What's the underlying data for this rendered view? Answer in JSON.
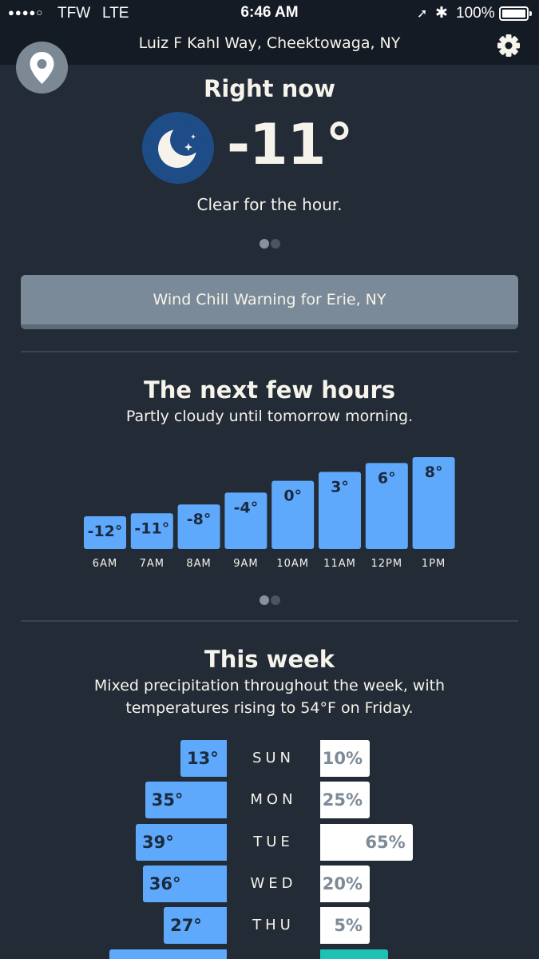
{
  "status_bar": {
    "signal": "●●●●○",
    "carrier": "TFW",
    "network": "LTE",
    "time": "6:46 AM",
    "battery": "100%"
  },
  "header": {
    "location": "Luiz F Kahl Way, Cheektowaga, NY",
    "icons": [
      "gear-icon",
      "location-pin-icon"
    ]
  },
  "current": {
    "title": "Right now",
    "icon": "clear-night-moon-icon",
    "temperature": "-11°",
    "summary": "Clear for the hour."
  },
  "alert": {
    "label": "Wind Chill Warning for Erie, NY"
  },
  "hourly": {
    "title": "The next few hours",
    "summary": "Partly cloudy until tomorrow morning."
  },
  "chart_data": {
    "type": "bar",
    "categories": [
      "6AM",
      "7AM",
      "8AM",
      "9AM",
      "10AM",
      "11AM",
      "12PM",
      "1PM"
    ],
    "values": [
      -12,
      -11,
      -8,
      -4,
      0,
      3,
      6,
      8
    ],
    "labels": [
      "-12°",
      "-11°",
      "-8°",
      "-4°",
      "0°",
      "3°",
      "6°",
      "8°"
    ],
    "bar_color": "#5ea9fb",
    "label_color": "#1c2a3f",
    "tick_color": "#f6f3ea"
  },
  "weekly": {
    "title": "This week",
    "summary_line1": "Mixed precipitation throughout the week, with",
    "summary_line2": "temperatures rising to 54°F on Friday.",
    "days": [
      {
        "day": "SUN",
        "temp": "13°",
        "temp_value": 13,
        "precip": "10%",
        "precip_value": 10
      },
      {
        "day": "MON",
        "temp": "35°",
        "temp_value": 35,
        "precip": "25%",
        "precip_value": 25
      },
      {
        "day": "TUE",
        "temp": "39°",
        "temp_value": 39,
        "precip": "65%",
        "precip_value": 65
      },
      {
        "day": "WED",
        "temp": "36°",
        "temp_value": 36,
        "precip": "20%",
        "precip_value": 20
      },
      {
        "day": "THU",
        "temp": "27°",
        "temp_value": 27,
        "precip": "5%",
        "precip_value": 5
      }
    ]
  },
  "colors": {
    "background": "#222b36",
    "header": "#151b24",
    "bar_blue": "#5ea9fb",
    "alert_gray": "#7b8a99",
    "precip_white": "#ffffff",
    "precip_teal": "#1fc1b5"
  }
}
